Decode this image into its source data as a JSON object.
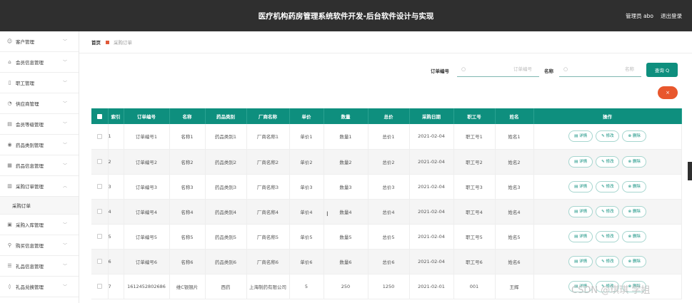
{
  "header": {
    "title": "医疗机构药房管理系统软件开发-后台软件设计与实现",
    "admin": "管理员 abo",
    "logout": "退出登录"
  },
  "sidebar": {
    "items": [
      {
        "label": "客户管理",
        "icon": "user-icon",
        "glyph": "☺"
      },
      {
        "label": "会员信息管理",
        "icon": "bank-icon",
        "glyph": "⌂"
      },
      {
        "label": "职工管理",
        "icon": "badge-icon",
        "glyph": "▯"
      },
      {
        "label": "供应商管理",
        "icon": "clock-icon",
        "glyph": "◔"
      },
      {
        "label": "会员等级管理",
        "icon": "list-icon",
        "glyph": "▤"
      },
      {
        "label": "药品类别管理",
        "icon": "location-icon",
        "glyph": "◉"
      },
      {
        "label": "药品信息管理",
        "icon": "grid-icon",
        "glyph": "▦"
      },
      {
        "label": "采购订单管理",
        "icon": "doc-icon",
        "glyph": "▥"
      },
      {
        "label": "采购入库管理",
        "icon": "box-icon",
        "glyph": "▣"
      },
      {
        "label": "购买信息管理",
        "icon": "person-icon",
        "glyph": "⚲"
      },
      {
        "label": "礼品信息管理",
        "icon": "menu-icon",
        "glyph": "☰"
      },
      {
        "label": "礼品兑换管理",
        "icon": "pin-icon",
        "glyph": "◊"
      }
    ],
    "submenu": "采购订单"
  },
  "breadcrumb": {
    "home": "首页",
    "current": "采购订单"
  },
  "search": {
    "order_label": "订单编号",
    "order_placeholder": "订单编号",
    "name_label": "名称",
    "name_placeholder": "名称",
    "query_button": "查询 Q",
    "delete_button": "×"
  },
  "table": {
    "headers": [
      "",
      "索引",
      "订单编号",
      "名称",
      "药品类别",
      "厂商名称",
      "单价",
      "数量",
      "总价",
      "采购日期",
      "职工号",
      "姓名",
      "操作"
    ],
    "rows": [
      [
        "1",
        "订单编号1",
        "名称1",
        "药品类别1",
        "厂商名称1",
        "单价1",
        "数量1",
        "总价1",
        "2021-02-04",
        "职工号1",
        "姓名1"
      ],
      [
        "2",
        "订单编号2",
        "名称2",
        "药品类别2",
        "厂商名称2",
        "单价2",
        "数量2",
        "总价2",
        "2021-02-04",
        "职工号2",
        "姓名2"
      ],
      [
        "3",
        "订单编号3",
        "名称3",
        "药品类别3",
        "厂商名称3",
        "单价3",
        "数量3",
        "总价3",
        "2021-02-04",
        "职工号3",
        "姓名3"
      ],
      [
        "4",
        "订单编号4",
        "名称4",
        "药品类别4",
        "厂商名称4",
        "单价4",
        "数量4",
        "总价4",
        "2021-02-04",
        "职工号4",
        "姓名4"
      ],
      [
        "5",
        "订单编号5",
        "名称5",
        "药品类别5",
        "厂商名称5",
        "单价5",
        "数量5",
        "总价5",
        "2021-02-04",
        "职工号5",
        "姓名5"
      ],
      [
        "6",
        "订单编号6",
        "名称6",
        "药品类别6",
        "厂商名称6",
        "单价6",
        "数量6",
        "总价6",
        "2021-02-04",
        "职工号6",
        "姓名6"
      ],
      [
        "7",
        "1612452802686",
        "维C银翘片",
        "西药",
        "上海制药有限公司",
        "5",
        "250",
        "1250",
        "2021-02-01",
        "001",
        "王辉"
      ]
    ],
    "actions": {
      "detail": "▤ 详情",
      "edit": "✎ 修改",
      "delete": "⊗ 删除"
    }
  },
  "watermark": "CSDN @琪琪 学姐",
  "colors": {
    "header_bg": "#2f2f2f",
    "accent": "#0e8f7e",
    "danger": "#e8572d"
  }
}
